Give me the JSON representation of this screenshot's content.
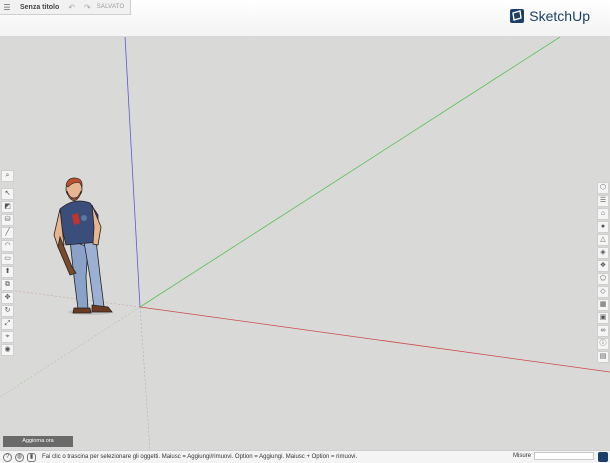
{
  "app": {
    "doc_title": "Senza titolo",
    "save_status": "SALVATO",
    "brand": "SketchUp"
  },
  "colors": {
    "axis_red": "#cc4b4b",
    "axis_green": "#53c253",
    "axis_blue": "#5a5ad6",
    "brand_blue": "#1b3f6b",
    "shirt": "#3b4d7a",
    "jeans": "#8aa1c8",
    "beard": "#b9512e"
  },
  "left_toolbar": {
    "icons": [
      "search-icon",
      "select-icon",
      "eraser-icon",
      "paint-bucket-icon",
      "line-icon",
      "arc-icon",
      "rectangle-icon",
      "push-pull-icon",
      "offset-icon",
      "move-icon",
      "rotate-icon",
      "scale-icon",
      "tape-measure-icon",
      "orbit-icon"
    ]
  },
  "right_toolbar": {
    "icons": [
      "entity-info-icon",
      "instructor-icon",
      "components-icon",
      "materials-icon",
      "styles-icon",
      "layers-icon",
      "scenes-icon",
      "shadows-icon",
      "display-icon",
      "outliner-icon",
      "view-icon",
      "glasses-icon",
      "info-icon",
      "clipboard-icon"
    ]
  },
  "update_button": "Aggiorna ora",
  "status": {
    "hint": "Fai clic o trascina per selezionare gli oggetti. Maiusc = Aggiungi/rimuovi. Option = Aggiungi. Maiusc + Option = rimuovi.",
    "measure_label": "Misure"
  }
}
